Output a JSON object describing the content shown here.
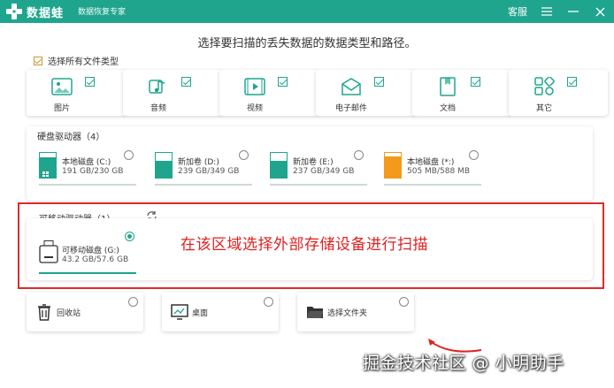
{
  "titlebar": {
    "app_name": "数据蛙",
    "subtitle": "数据恢复专家",
    "support_label": "客服",
    "accent": "#1fa58d"
  },
  "main_title": "选择要扫描的丢失数据的数据类型和路径。",
  "select_all_label": "选择所有文件类型",
  "file_types": [
    {
      "label": "图片",
      "icon": "image-icon",
      "checked": true
    },
    {
      "label": "音频",
      "icon": "music-icon",
      "checked": true
    },
    {
      "label": "视频",
      "icon": "video-icon",
      "checked": true
    },
    {
      "label": "电子邮件",
      "icon": "mail-icon",
      "checked": true
    },
    {
      "label": "文档",
      "icon": "document-icon",
      "checked": true
    },
    {
      "label": "其它",
      "icon": "grid-icon",
      "checked": true
    }
  ],
  "hard_drives": {
    "title": "硬盘驱动器（4）",
    "items": [
      {
        "name": "本地磁盘 (C:)",
        "size": "191 GB/230 GB",
        "usage": 0.83,
        "color": "#1fa58d"
      },
      {
        "name": "新加卷 (D:)",
        "size": "239 GB/349 GB",
        "usage": 0.68,
        "color": "#1fa58d"
      },
      {
        "name": "新加卷 (E:)",
        "size": "237 GB/349 GB",
        "usage": 0.68,
        "color": "#1fa58d"
      },
      {
        "name": "本地磁盘 (*:)",
        "size": "505 MB/588 MB",
        "usage": 0.86,
        "color": "#f39a1d"
      }
    ]
  },
  "removable": {
    "title": "可移动驱动器（1）",
    "items": [
      {
        "name": "可移动磁盘 (G:)",
        "size": "43.2 GB/57.6 GB",
        "usage": 0.75,
        "selected": true
      }
    ]
  },
  "annotation": "在该区域选择外部存储设备进行扫描",
  "bottom_tiles": [
    {
      "label": "回收站",
      "icon": "trash-icon"
    },
    {
      "label": "桌面",
      "icon": "desktop-icon"
    },
    {
      "label": "选择文件夹",
      "icon": "folder-icon"
    }
  ],
  "watermark": "掘金技术社区 @ 小明助手"
}
